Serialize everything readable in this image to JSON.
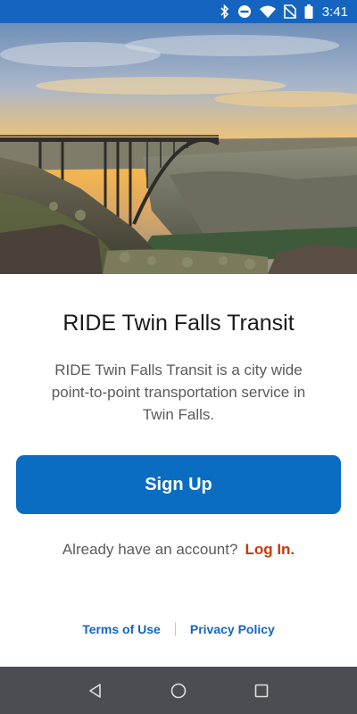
{
  "status_bar": {
    "time": "3:41",
    "icons": [
      "bluetooth-icon",
      "do-not-disturb-icon",
      "wifi-icon",
      "no-sim-icon",
      "battery-icon"
    ],
    "background_color": "#1565c0"
  },
  "hero": {
    "image": "bridge-canyon-sunset-photo"
  },
  "main": {
    "title": "RIDE Twin Falls Transit",
    "description": "RIDE Twin Falls Transit is a city wide point-to-point transportation service in Twin Falls.",
    "signup_label": "Sign Up",
    "login_prompt": "Already have an account?",
    "login_label": "Log In."
  },
  "footer": {
    "terms_label": "Terms of Use",
    "privacy_label": "Privacy Policy"
  },
  "nav_bar": {
    "buttons": [
      "back-icon",
      "home-icon",
      "recents-icon"
    ]
  },
  "colors": {
    "primary": "#0a6dc2",
    "login_link": "#c8380e",
    "footer_link": "#1565c0"
  }
}
